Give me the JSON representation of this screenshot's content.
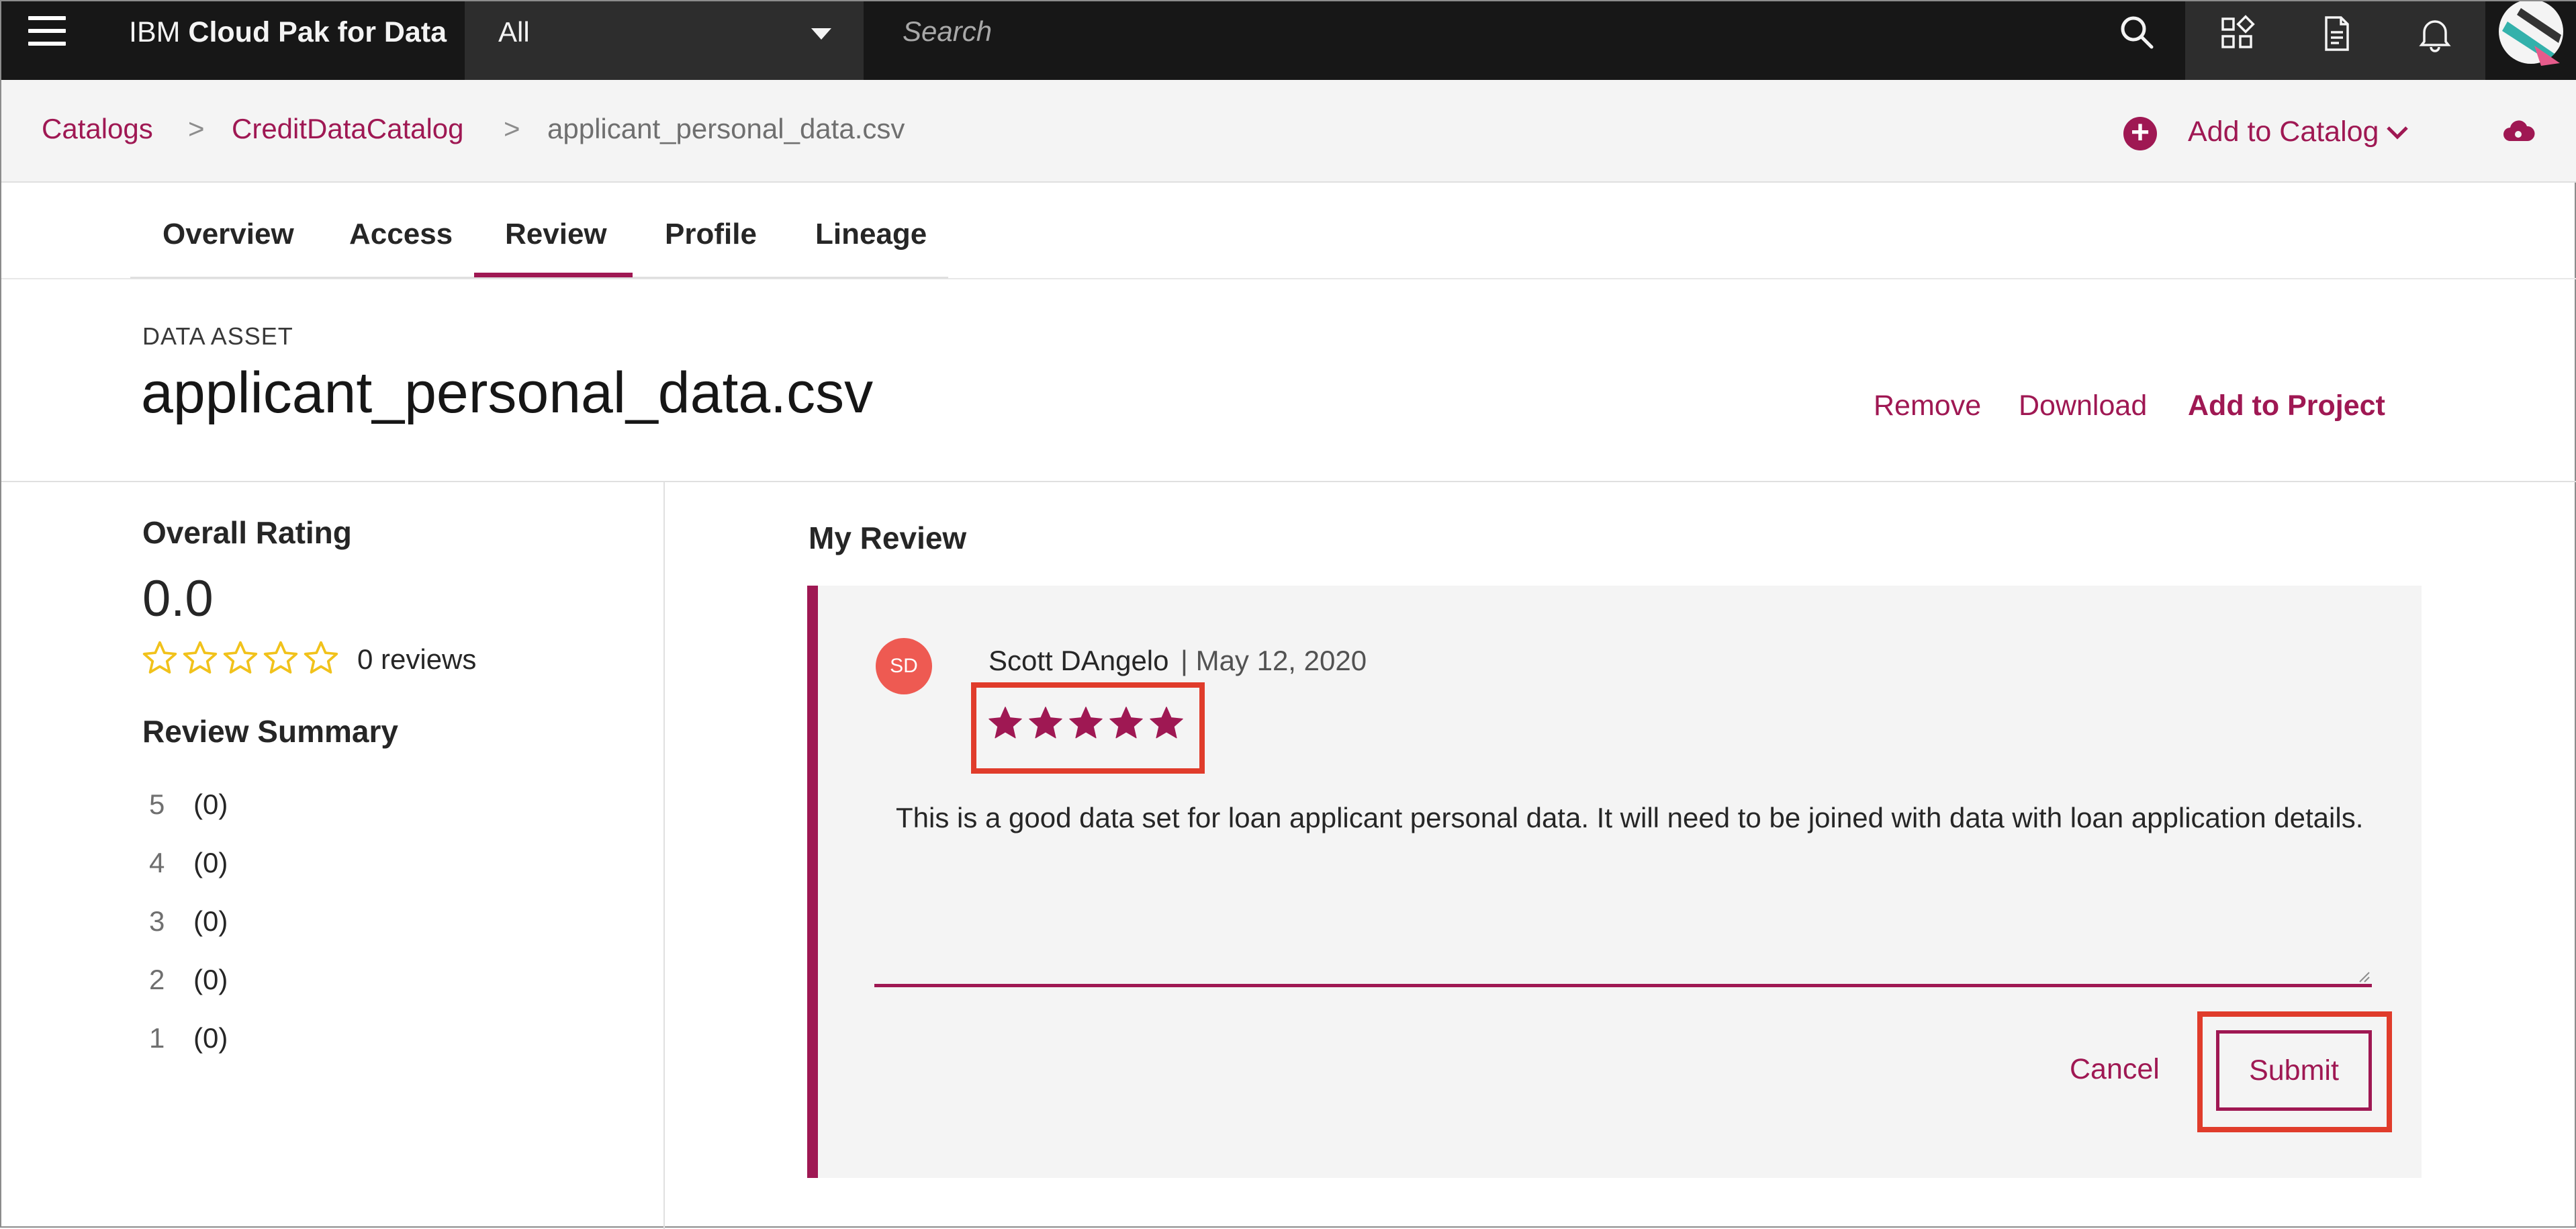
{
  "header": {
    "product_prefix": "IBM",
    "product_name": "Cloud Pak for Data",
    "scope_selected": "All",
    "search_placeholder": "Search"
  },
  "breadcrumb": {
    "items": [
      "Catalogs",
      "CreditDataCatalog",
      "applicant_personal_data.csv"
    ],
    "separator": ">"
  },
  "actions": {
    "add_to_catalog": "Add to Catalog"
  },
  "tabs": [
    {
      "label": "Overview",
      "active": false
    },
    {
      "label": "Access",
      "active": false
    },
    {
      "label": "Review",
      "active": true
    },
    {
      "label": "Profile",
      "active": false
    },
    {
      "label": "Lineage",
      "active": false
    }
  ],
  "asset": {
    "type": "DATA ASSET",
    "title": "applicant_personal_data.csv",
    "actions": [
      "Remove",
      "Download",
      "Add to Project"
    ]
  },
  "overall": {
    "title": "Overall Rating",
    "value": "0.0",
    "rating": 0,
    "max_rating": 5,
    "reviews": "0 reviews"
  },
  "summary": {
    "title": "Review Summary",
    "rows": [
      {
        "stars": "5",
        "count": "(0)"
      },
      {
        "stars": "4",
        "count": "(0)"
      },
      {
        "stars": "3",
        "count": "(0)"
      },
      {
        "stars": "2",
        "count": "(0)"
      },
      {
        "stars": "1",
        "count": "(0)"
      }
    ]
  },
  "my_review": {
    "title": "My Review",
    "initials": "SD",
    "name": "Scott DAngelo",
    "date": "| May 12, 2020",
    "rating": 5,
    "text": "This is a good data set for loan applicant personal data. It will need to be joined with data with loan application details.",
    "cancel_label": "Cancel",
    "submit_label": "Submit"
  },
  "colors": {
    "accent": "#9f1853",
    "highlight": "#e03c2b",
    "star_empty": "#f1c21b",
    "topbar": "#171717",
    "avatar": "#ee5a52"
  },
  "icons": [
    "hamburger-icon",
    "chevron-down-icon",
    "search-icon",
    "apps-icon",
    "document-icon",
    "notification-icon",
    "user-avatar-icon",
    "add-circle-icon",
    "cloud-icon",
    "star-icon"
  ]
}
